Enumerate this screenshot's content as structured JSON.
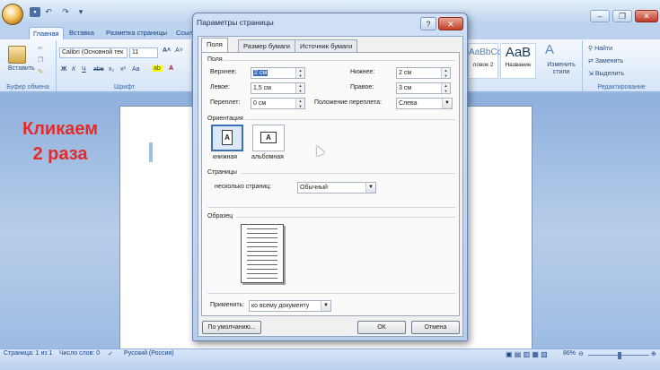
{
  "word": {
    "tabs": [
      "Главная",
      "Вставка",
      "Разметка страницы",
      "Ссыл"
    ],
    "font_name": "Calibri (Основной тек",
    "font_size": "11",
    "paste_label": "Вставить",
    "group_clipboard": "Буфер обмена",
    "group_font": "Шрифт",
    "style_tiles": [
      {
        "preview": "AaBbCc",
        "label": "ловок 2"
      },
      {
        "preview": "AaB",
        "label": "Название"
      }
    ],
    "change_styles_label": "Изменить стили",
    "editing_items": [
      "Найти",
      "Заменить",
      "Выделить"
    ],
    "group_editing": "Редактирование",
    "caption_lines": [
      "Кликаем",
      "2 раза"
    ],
    "status": {
      "page": "Страница: 1 из 1",
      "words": "Число слов: 0",
      "language": "Русский (Россия)",
      "zoom": "86%"
    }
  },
  "dialog": {
    "title": "Параметры страницы",
    "tabs": [
      "Поля",
      "Размер бумаги",
      "Источник бумаги"
    ],
    "section_margins": "Поля",
    "fields": {
      "top": {
        "label": "Верхнее:",
        "value": "2 см"
      },
      "bottom": {
        "label": "Нижнее:",
        "value": "2 см"
      },
      "left": {
        "label": "Левое:",
        "value": "1,5 см"
      },
      "right": {
        "label": "Правое:",
        "value": "3 см"
      },
      "gutter": {
        "label": "Переплет:",
        "value": "0 см"
      },
      "gutter_pos": {
        "label": "Положение переплета:",
        "value": "Слева"
      }
    },
    "section_orientation": "Ориентация",
    "orientation": {
      "portrait": "книжная",
      "landscape": "альбомная"
    },
    "section_pages": "Страницы",
    "multiple_pages": {
      "label": "несколько страниц:",
      "value": "Обычный"
    },
    "section_preview": "Образец",
    "apply": {
      "label": "Применить:",
      "value": "ко всему документу"
    },
    "buttons": {
      "default": "По умолчанию...",
      "ok": "ОК",
      "cancel": "Отмена"
    }
  }
}
